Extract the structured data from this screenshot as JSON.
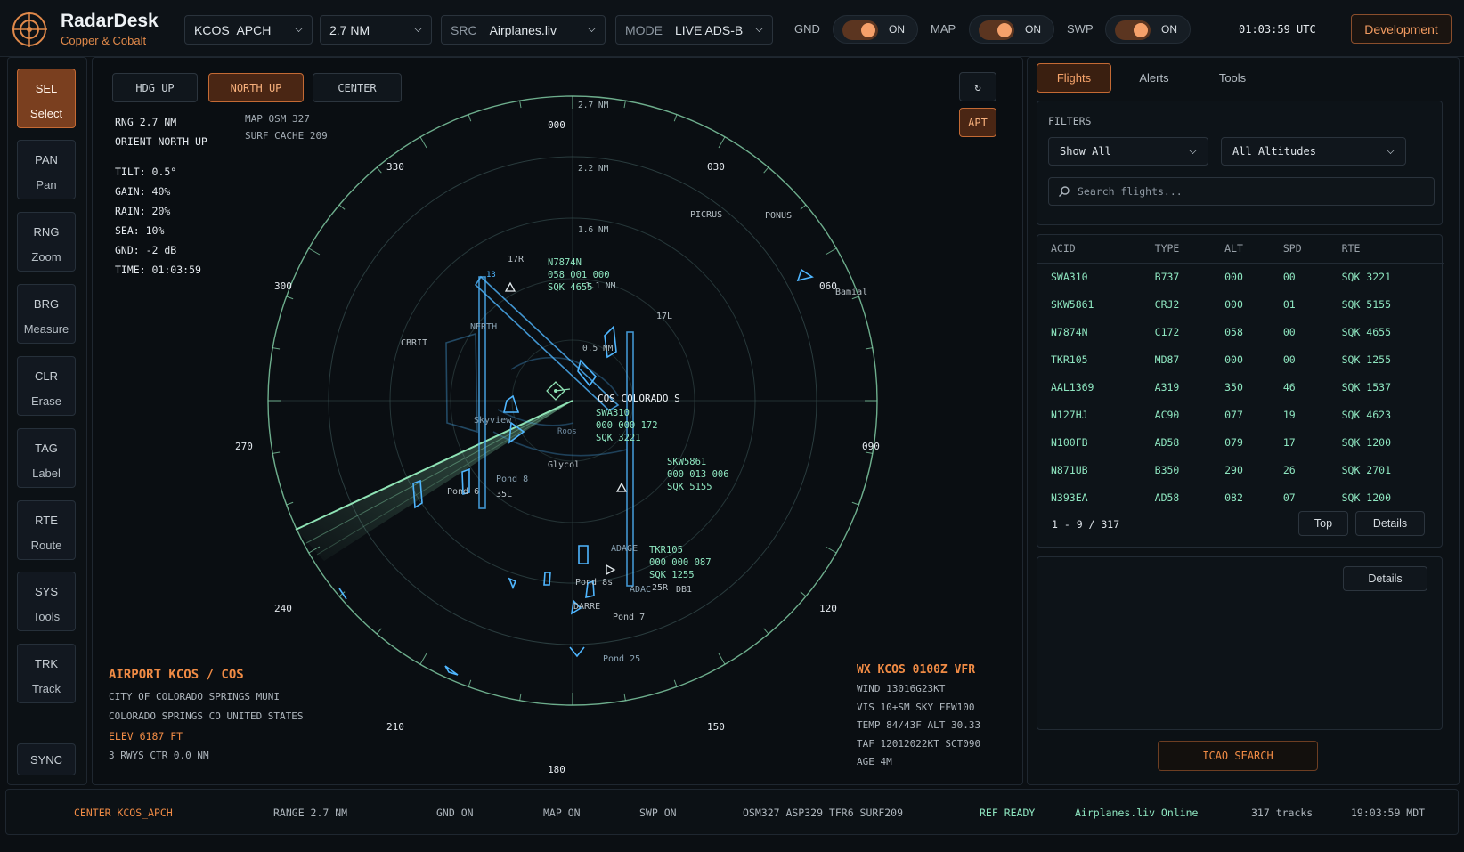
{
  "app": {
    "name": "RadarDesk",
    "subtitle": "Copper & Cobalt",
    "clock": "01:03:59 UTC",
    "env_button": "Development"
  },
  "controls": {
    "facility": "KCOS_APCH",
    "range": "2.7 NM",
    "source": {
      "label": "SRC",
      "value": "Airplanes.liv"
    },
    "mode": {
      "label": "MODE",
      "value": "LIVE ADS-B"
    },
    "toggles": [
      {
        "label": "GND",
        "state": "ON"
      },
      {
        "label": "MAP",
        "state": "ON"
      },
      {
        "label": "SWP",
        "state": "ON"
      }
    ]
  },
  "tools": [
    {
      "code": "SEL",
      "name": "Select",
      "active": true
    },
    {
      "code": "PAN",
      "name": "Pan"
    },
    {
      "code": "RNG",
      "name": "Zoom"
    },
    {
      "code": "BRG",
      "name": "Measure"
    },
    {
      "code": "CLR",
      "name": "Erase"
    },
    {
      "code": "TAG",
      "name": "Label"
    },
    {
      "code": "RTE",
      "name": "Route"
    },
    {
      "code": "SYS",
      "name": "Tools"
    },
    {
      "code": "TRK",
      "name": "Track"
    }
  ],
  "sync_label": "SYNC",
  "radar": {
    "view_buttons": [
      "HDG UP",
      "NORTH UP",
      "CENTER"
    ],
    "active_view": "NORTH UP",
    "refresh_icon": "↻",
    "apt_button": "APT",
    "info": [
      "RNG  2.7 NM",
      "ORIENT NORTH UP"
    ],
    "info_params": [
      "TILT: 0.5°",
      "GAIN: 40%",
      "RAIN: 20%",
      "SEA: 10%",
      "GND: -2 dB",
      "TIME: 01:03:59"
    ],
    "map_info": [
      "MAP OSM 327",
      "SURF CACHE 209"
    ],
    "range_rings": [
      "2.7 NM",
      "2.2 NM",
      "1.6 NM",
      "0.5 NM"
    ],
    "bearings": [
      "000",
      "030",
      "060",
      "090",
      "120",
      "150",
      "180",
      "210",
      "240",
      "270",
      "300",
      "330"
    ],
    "map_labels": {
      "picrus": "PICRUS",
      "ponus": "PONUS",
      "bamia": "Bamial",
      "cbrit": "CBRIT",
      "north": "NERTH",
      "skyview": "Skyview",
      "glycol": "Glycol",
      "pond6": "Pond 6",
      "pond8": "Pond 8",
      "pond8s": "Pond 8s",
      "pond7": "Pond 7",
      "pond25": "Pond 25",
      "darre": "DARRE",
      "adage": "ADAGE",
      "adac": "ADAC",
      "db1": "DB1",
      "rwy17r": "17R",
      "rwy17l": "17L",
      "rwy35l": "35L",
      "rwy25r": "25R",
      "num13": "13",
      "center": "COS COLORADO S",
      "range_1_1": "1.1 NM",
      "roost": "Roos"
    },
    "targets": [
      {
        "callsign": "N7874N",
        "line2": "058 001 000",
        "line3": "SQK 4655"
      },
      {
        "callsign": "SWA310",
        "line2": "000 000 172",
        "line3": "SQK 3221"
      },
      {
        "callsign": "SKW5861",
        "line2": "000 013 006",
        "line3": "SQK 5155"
      },
      {
        "callsign": "TKR105",
        "line2": "000 000 087",
        "line3": "SQK 1255"
      }
    ],
    "airport": {
      "title": "AIRPORT  KCOS / COS",
      "lines": [
        "CITY OF COLORADO SPRINGS MUNI",
        "COLORADO SPRINGS CO UNITED STATES"
      ],
      "elev": "ELEV 6187 FT",
      "rwys": "3 RWYS   CTR 0.0 NM"
    },
    "wx": {
      "title": "WX KCOS 0100Z VFR",
      "lines": [
        "WIND 13016G23KT",
        "VIS 10+SM  SKY FEW100",
        "TEMP 84/43F  ALT 30.33",
        "TAF 12012022KT SCT090",
        "AGE 4M"
      ]
    }
  },
  "panel": {
    "tabs": [
      "Flights",
      "Alerts",
      "Tools"
    ],
    "active_tab": "Flights",
    "filters_label": "FILTERS",
    "filter_show": "Show All",
    "filter_alt": "All Altitudes",
    "search_placeholder": "Search flights...",
    "columns": [
      "ACID",
      "TYPE",
      "ALT",
      "SPD",
      "RTE"
    ],
    "flights": [
      [
        "SWA310",
        "B737",
        "000",
        "00",
        "SQK 3221"
      ],
      [
        "SKW5861",
        "CRJ2",
        "000",
        "01",
        "SQK 5155"
      ],
      [
        "N7874N",
        "C172",
        "058",
        "00",
        "SQK 4655"
      ],
      [
        "TKR105",
        "MD87",
        "000",
        "00",
        "SQK 1255"
      ],
      [
        "AAL1369",
        "A319",
        "350",
        "46",
        "SQK 1537"
      ],
      [
        "N127HJ",
        "AC90",
        "077",
        "19",
        "SQK 4623"
      ],
      [
        "N100FB",
        "AD58",
        "079",
        "17",
        "SQK 1200"
      ],
      [
        "N871UB",
        "B350",
        "290",
        "26",
        "SQK 2701"
      ],
      [
        "N393EA",
        "AD58",
        "082",
        "07",
        "SQK 1200"
      ]
    ],
    "pagination": "1 - 9 / 317",
    "top_btn": "Top",
    "details_btn": "Details",
    "details_btn2": "Details",
    "icao_btn": "ICAO SEARCH"
  },
  "status": [
    "CENTER KCOS_APCH",
    "RANGE 2.7 NM",
    "GND ON",
    "MAP ON",
    "SWP ON",
    "OSM327  ASP329  TFR6  SURF209",
    "REF READY",
    "Airplanes.liv  Online",
    "317 tracks",
    "19:03:59 MDT"
  ],
  "colors": {
    "accent": "#f08b45",
    "ring": "#8fe3b5",
    "map": "#4fb6ff",
    "data": "#8ee6c0"
  }
}
